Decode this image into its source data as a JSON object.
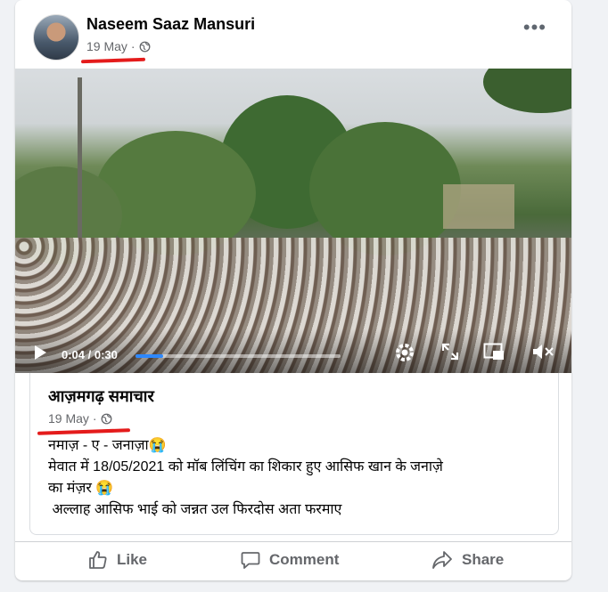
{
  "post": {
    "author": "Naseem Saaz Mansuri",
    "date": "19 May",
    "privacy_icon": "globe-icon",
    "more_icon": "more-options-icon",
    "more_label": "•••"
  },
  "video": {
    "current_time": "0:04 / 0:30",
    "progress_fraction": 0.133
  },
  "shared_post": {
    "page_name": "आज़मगढ़ समाचार",
    "date": "19 May",
    "text_lines": [
      "नमाज़ - ए - जनाज़ा😭",
      "मेवात में 18/05/2021 को मॉब लिंचिंग का शिकार हुए आसिफ खान के जनाज़े",
      "का मंज़र 😭",
      " अल्लाह आसिफ भाई को जन्नत उल फिरदोस अता फरमाए"
    ]
  },
  "actions": {
    "like": "Like",
    "comment": "Comment",
    "share": "Share"
  },
  "colors": {
    "annotation_underline": "#e41b1b",
    "progress": "#2d88ff",
    "meta_text": "#65676b"
  }
}
